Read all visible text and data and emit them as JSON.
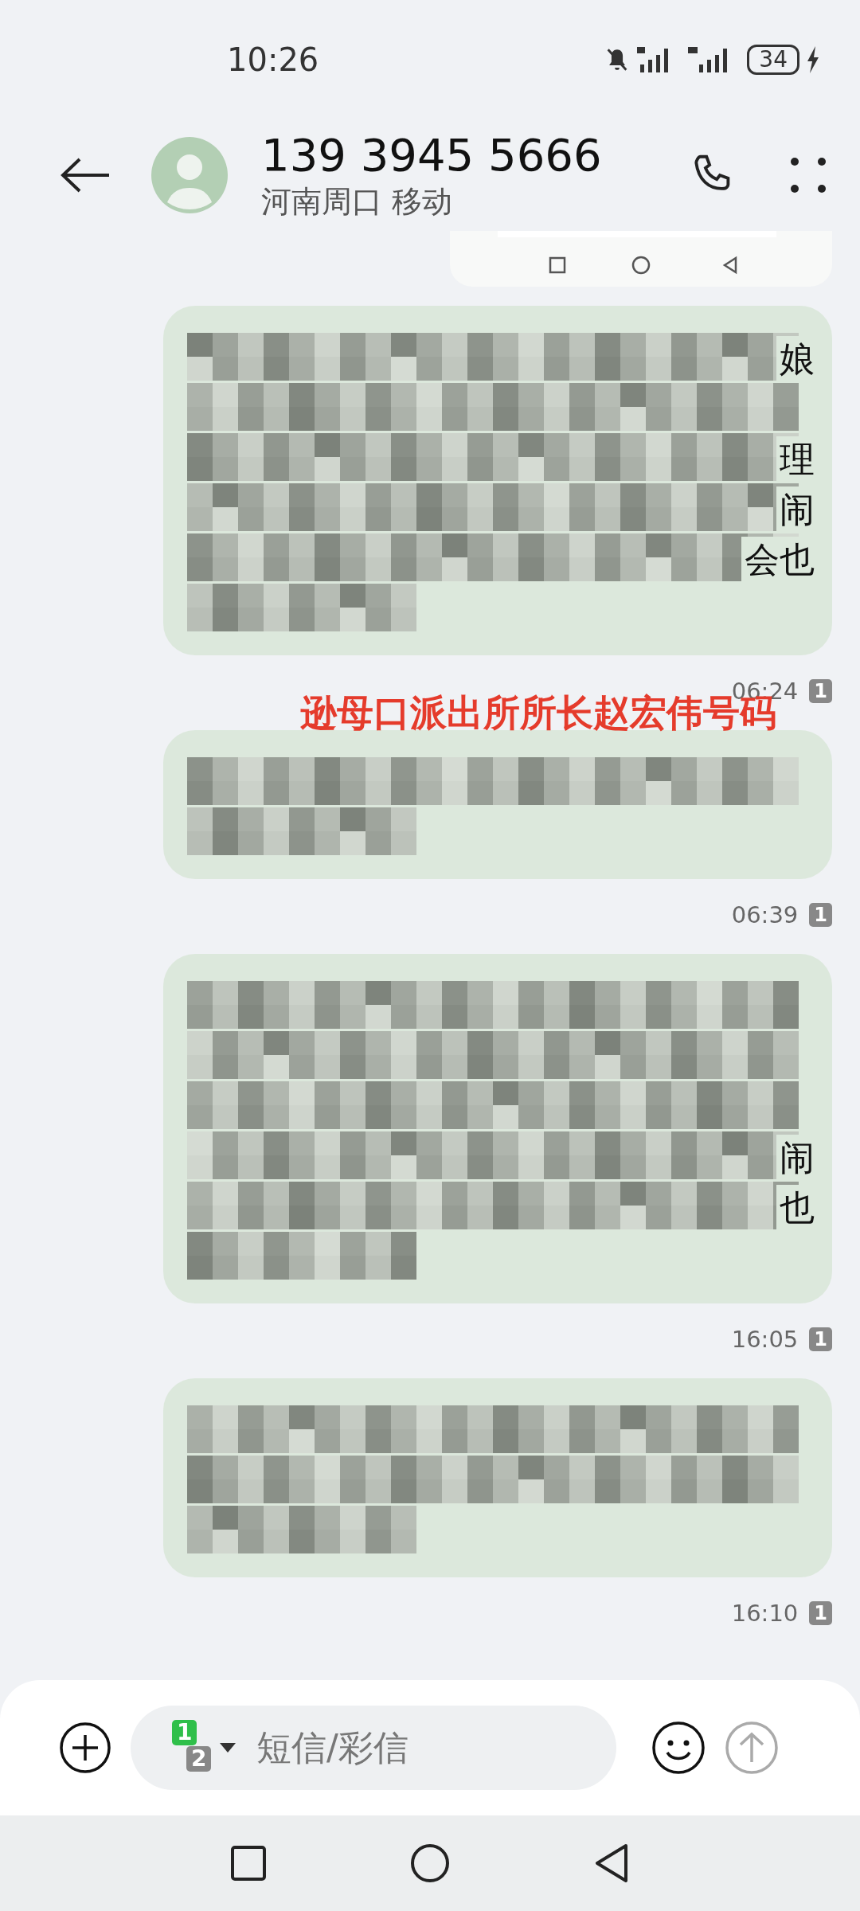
{
  "status_bar": {
    "time": "10:26",
    "battery": "34"
  },
  "header": {
    "title": "139 3945 5666",
    "subtitle": "河南周口 移动"
  },
  "messages": [
    {
      "lines": [
        {
          "redacted": true,
          "short": false,
          "tail": "娘"
        },
        {
          "redacted": true,
          "short": false
        },
        {
          "redacted": true,
          "short": false,
          "tail": "理"
        },
        {
          "redacted": true,
          "short": false,
          "tail": "闹"
        },
        {
          "redacted": true,
          "short": false,
          "tail": "会也"
        },
        {
          "redacted": true,
          "short": true
        }
      ],
      "time": "06:24",
      "sim": "1"
    },
    {
      "lines": [
        {
          "redacted": true,
          "short": false
        },
        {
          "redacted": true,
          "short": true
        }
      ],
      "time": "06:39",
      "sim": "1"
    },
    {
      "lines": [
        {
          "redacted": true,
          "short": false
        },
        {
          "redacted": true,
          "short": false
        },
        {
          "redacted": true,
          "short": false
        },
        {
          "redacted": true,
          "short": false,
          "tail": "闹"
        },
        {
          "redacted": true,
          "short": false,
          "tail": "也"
        },
        {
          "redacted": true,
          "short": true
        }
      ],
      "time": "16:05",
      "sim": "1"
    },
    {
      "lines": [
        {
          "redacted": true,
          "short": false
        },
        {
          "redacted": true,
          "short": false
        },
        {
          "redacted": true,
          "short": true
        }
      ],
      "time": "16:10",
      "sim": "1"
    }
  ],
  "annotation": "逊母口派出所所长赵宏伟号码",
  "composer": {
    "sim_primary": "1",
    "sim_secondary": "2",
    "placeholder": "短信/彩信"
  }
}
